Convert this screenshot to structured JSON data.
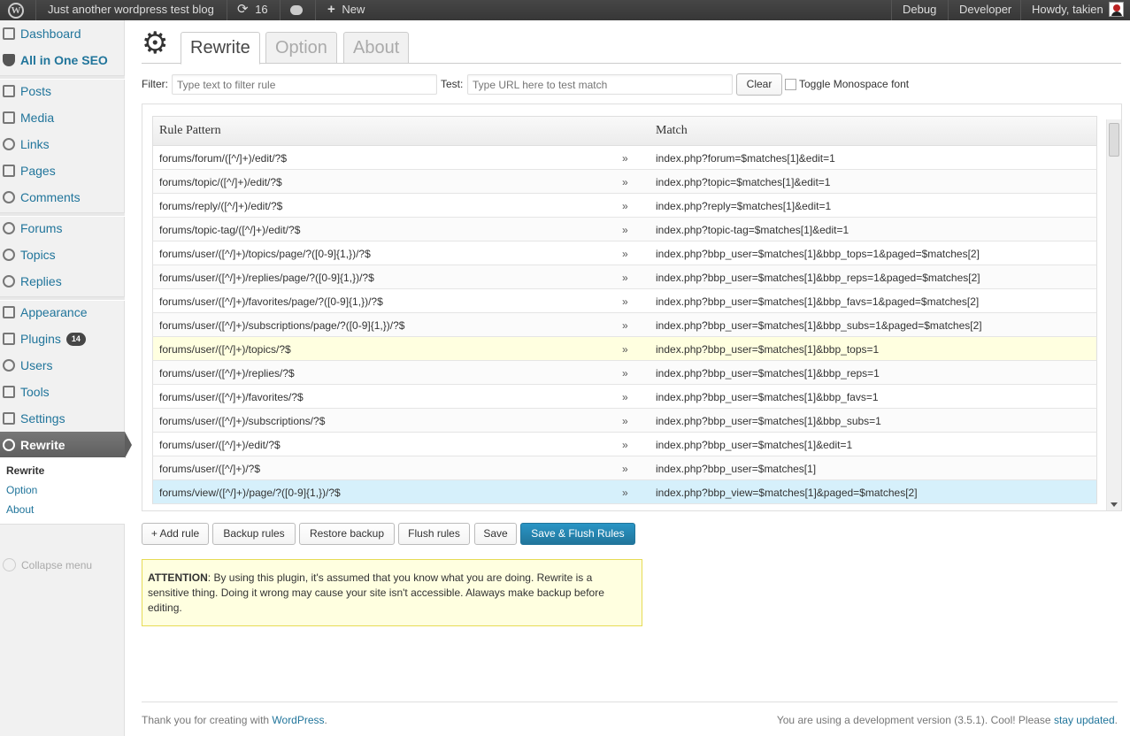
{
  "adminbar": {
    "site_title": "Just another wordpress test blog",
    "updates_count": "16",
    "new_label": "New",
    "debug_label": "Debug",
    "developer_label": "Developer",
    "howdy": "Howdy, takien"
  },
  "sidebar": {
    "items": [
      {
        "label": "Dashboard",
        "icon": "dashboard-icon"
      },
      {
        "label": "All in One SEO",
        "icon": "shield-icon"
      },
      {
        "label": "Posts",
        "icon": "pin-icon"
      },
      {
        "label": "Media",
        "icon": "media-icon"
      },
      {
        "label": "Links",
        "icon": "link-icon"
      },
      {
        "label": "Pages",
        "icon": "pages-icon"
      },
      {
        "label": "Comments",
        "icon": "comment-icon"
      },
      {
        "label": "Forums",
        "icon": "forums-icon"
      },
      {
        "label": "Topics",
        "icon": "topics-icon"
      },
      {
        "label": "Replies",
        "icon": "replies-icon"
      },
      {
        "label": "Appearance",
        "icon": "appearance-icon"
      },
      {
        "label": "Plugins",
        "icon": "plugins-icon",
        "badge": "14"
      },
      {
        "label": "Users",
        "icon": "users-icon"
      },
      {
        "label": "Tools",
        "icon": "tools-icon"
      },
      {
        "label": "Settings",
        "icon": "settings-icon"
      },
      {
        "label": "Rewrite",
        "icon": "gear-icon"
      }
    ],
    "submenu": [
      "Rewrite",
      "Option",
      "About"
    ],
    "collapse_label": "Collapse menu"
  },
  "tabs": [
    "Rewrite",
    "Option",
    "About"
  ],
  "filter": {
    "filter_label": "Filter:",
    "filter_placeholder": "Type text to filter rule",
    "test_label": "Test:",
    "test_placeholder": "Type URL here to test match",
    "clear_label": "Clear",
    "mono_label": "Toggle Monospace font"
  },
  "table": {
    "col_pattern": "Rule Pattern",
    "col_match": "Match",
    "arrow": "»",
    "rows": [
      {
        "pattern": "forums/forum/([^/]+)/edit/?$",
        "match": "index.php?forum=$matches[1]&edit=1"
      },
      {
        "pattern": "forums/topic/([^/]+)/edit/?$",
        "match": "index.php?topic=$matches[1]&edit=1"
      },
      {
        "pattern": "forums/reply/([^/]+)/edit/?$",
        "match": "index.php?reply=$matches[1]&edit=1"
      },
      {
        "pattern": "forums/topic-tag/([^/]+)/edit/?$",
        "match": "index.php?topic-tag=$matches[1]&edit=1"
      },
      {
        "pattern": "forums/user/([^/]+)/topics/page/?([0-9]{1,})/?$",
        "match": "index.php?bbp_user=$matches[1]&bbp_tops=1&paged=$matches[2]"
      },
      {
        "pattern": "forums/user/([^/]+)/replies/page/?([0-9]{1,})/?$",
        "match": "index.php?bbp_user=$matches[1]&bbp_reps=1&paged=$matches[2]"
      },
      {
        "pattern": "forums/user/([^/]+)/favorites/page/?([0-9]{1,})/?$",
        "match": "index.php?bbp_user=$matches[1]&bbp_favs=1&paged=$matches[2]"
      },
      {
        "pattern": "forums/user/([^/]+)/subscriptions/page/?([0-9]{1,})/?$",
        "match": "index.php?bbp_user=$matches[1]&bbp_subs=1&paged=$matches[2]"
      },
      {
        "pattern": "forums/user/([^/]+)/topics/?$",
        "match": "index.php?bbp_user=$matches[1]&bbp_tops=1",
        "state": "hl"
      },
      {
        "pattern": "forums/user/([^/]+)/replies/?$",
        "match": "index.php?bbp_user=$matches[1]&bbp_reps=1"
      },
      {
        "pattern": "forums/user/([^/]+)/favorites/?$",
        "match": "index.php?bbp_user=$matches[1]&bbp_favs=1"
      },
      {
        "pattern": "forums/user/([^/]+)/subscriptions/?$",
        "match": "index.php?bbp_user=$matches[1]&bbp_subs=1"
      },
      {
        "pattern": "forums/user/([^/]+)/edit/?$",
        "match": "index.php?bbp_user=$matches[1]&edit=1"
      },
      {
        "pattern": "forums/user/([^/]+)/?$",
        "match": "index.php?bbp_user=$matches[1]"
      },
      {
        "pattern": "forums/view/([^/]+)/page/?([0-9]{1,})/?$",
        "match": "index.php?bbp_view=$matches[1]&paged=$matches[2]",
        "state": "sel"
      }
    ]
  },
  "actions": {
    "add_rule": "+ Add rule",
    "backup": "Backup rules",
    "restore": "Restore backup",
    "flush": "Flush rules",
    "save": "Save",
    "save_flush": "Save & Flush Rules"
  },
  "notice": {
    "strong": "ATTENTION",
    "text": ": By using this plugin, it's assumed that you know what you are doing. Rewrite is a sensitive thing. Doing it wrong may cause your site isn't accessible. Alaways make backup before editing."
  },
  "footer": {
    "thanks_prefix": "Thank you for creating with ",
    "thanks_link": "WordPress",
    "thanks_suffix": ".",
    "version_prefix": "You are using a development version (3.5.1). Cool! Please ",
    "version_link": "stay updated",
    "version_suffix": "."
  },
  "colors": {
    "link": "#21759b",
    "adminbar": "#464646",
    "primary_button": "#21759b",
    "notice_bg": "#ffffe0",
    "selected_row": "#d6f0fb"
  }
}
